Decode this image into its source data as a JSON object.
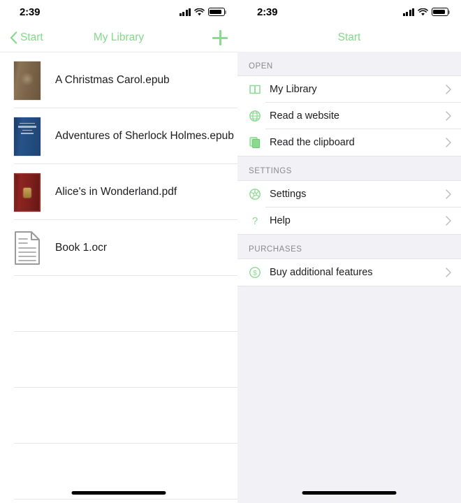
{
  "theme": {
    "accent_green": "#84d98a",
    "panel_bg": "#f2f1f6",
    "text_primary": "#1c1c1e",
    "text_secondary": "#8a8a8e"
  },
  "left_screen": {
    "status_bar": {
      "time": "2:39",
      "signal_icon": "cellular-signal-icon",
      "wifi_icon": "wifi-icon",
      "battery_icon": "battery-icon"
    },
    "navbar": {
      "back_label": "Start",
      "title": "My Library",
      "add_icon": "plus-icon"
    },
    "books": [
      {
        "title": "A Christmas Carol.epub",
        "cover": "cover-brown",
        "icon": "book-cover-thumbnail"
      },
      {
        "title": "Adventures of Sherlock Holmes.epub",
        "cover": "cover-blue",
        "icon": "book-cover-thumbnail"
      },
      {
        "title": "Alice's in Wonderland.pdf",
        "cover": "cover-red",
        "icon": "book-cover-thumbnail"
      },
      {
        "title": "Book 1.ocr",
        "cover": "cover-doc",
        "icon": "document-icon"
      }
    ],
    "empty_row_count": 4
  },
  "right_screen": {
    "status_bar": {
      "time": "2:39",
      "signal_icon": "cellular-signal-icon",
      "wifi_icon": "wifi-icon",
      "battery_icon": "battery-icon"
    },
    "navbar": {
      "title": "Start"
    },
    "sections": [
      {
        "header": "OPEN",
        "items": [
          {
            "label": "My Library",
            "icon": "open-book-icon",
            "chevron": "chevron-right-icon"
          },
          {
            "label": "Read a website",
            "icon": "globe-icon",
            "chevron": "chevron-right-icon"
          },
          {
            "label": "Read the clipboard",
            "icon": "clipboard-icon",
            "chevron": "chevron-right-icon"
          }
        ]
      },
      {
        "header": "SETTINGS",
        "items": [
          {
            "label": "Settings",
            "icon": "gear-icon",
            "chevron": "chevron-right-icon"
          },
          {
            "label": "Help",
            "icon": "question-mark-icon",
            "chevron": "chevron-right-icon"
          }
        ]
      },
      {
        "header": "PURCHASES",
        "items": [
          {
            "label": "Buy additional features",
            "icon": "dollar-circle-icon",
            "chevron": "chevron-right-icon"
          }
        ]
      }
    ]
  }
}
